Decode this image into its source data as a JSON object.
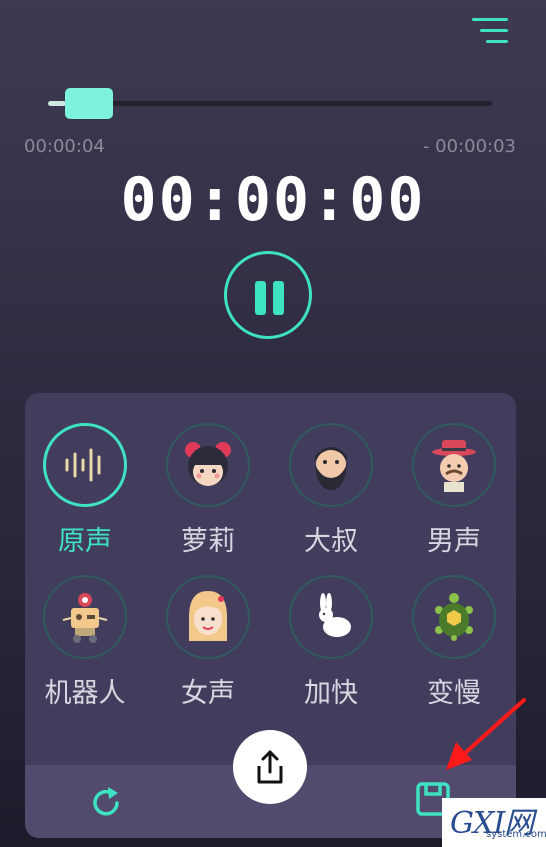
{
  "player": {
    "progress": 0.04,
    "elapsed": "00:00:04",
    "remaining": "- 00:00:03",
    "clock": "00:00:00"
  },
  "effects": [
    {
      "label": "原声",
      "icon": "waveform-icon",
      "active": true
    },
    {
      "label": "萝莉",
      "icon": "girl-avatar-icon",
      "active": false
    },
    {
      "label": "大叔",
      "icon": "bearded-man-icon",
      "active": false
    },
    {
      "label": "男声",
      "icon": "man-hat-icon",
      "active": false
    },
    {
      "label": "机器人",
      "icon": "robot-icon",
      "active": false
    },
    {
      "label": "女声",
      "icon": "woman-avatar-icon",
      "active": false
    },
    {
      "label": "加快",
      "icon": "rabbit-icon",
      "active": false
    },
    {
      "label": "变慢",
      "icon": "turtle-icon",
      "active": false
    }
  ],
  "toolbar": {
    "icons": [
      "refresh-icon",
      "share-icon",
      "save-icon"
    ]
  },
  "watermark": {
    "main": "GXI网",
    "sub": "system.com"
  },
  "colors": {
    "accent": "#3ee3c2",
    "panel": "#433d5d",
    "annotation": "#ff1a1a"
  }
}
